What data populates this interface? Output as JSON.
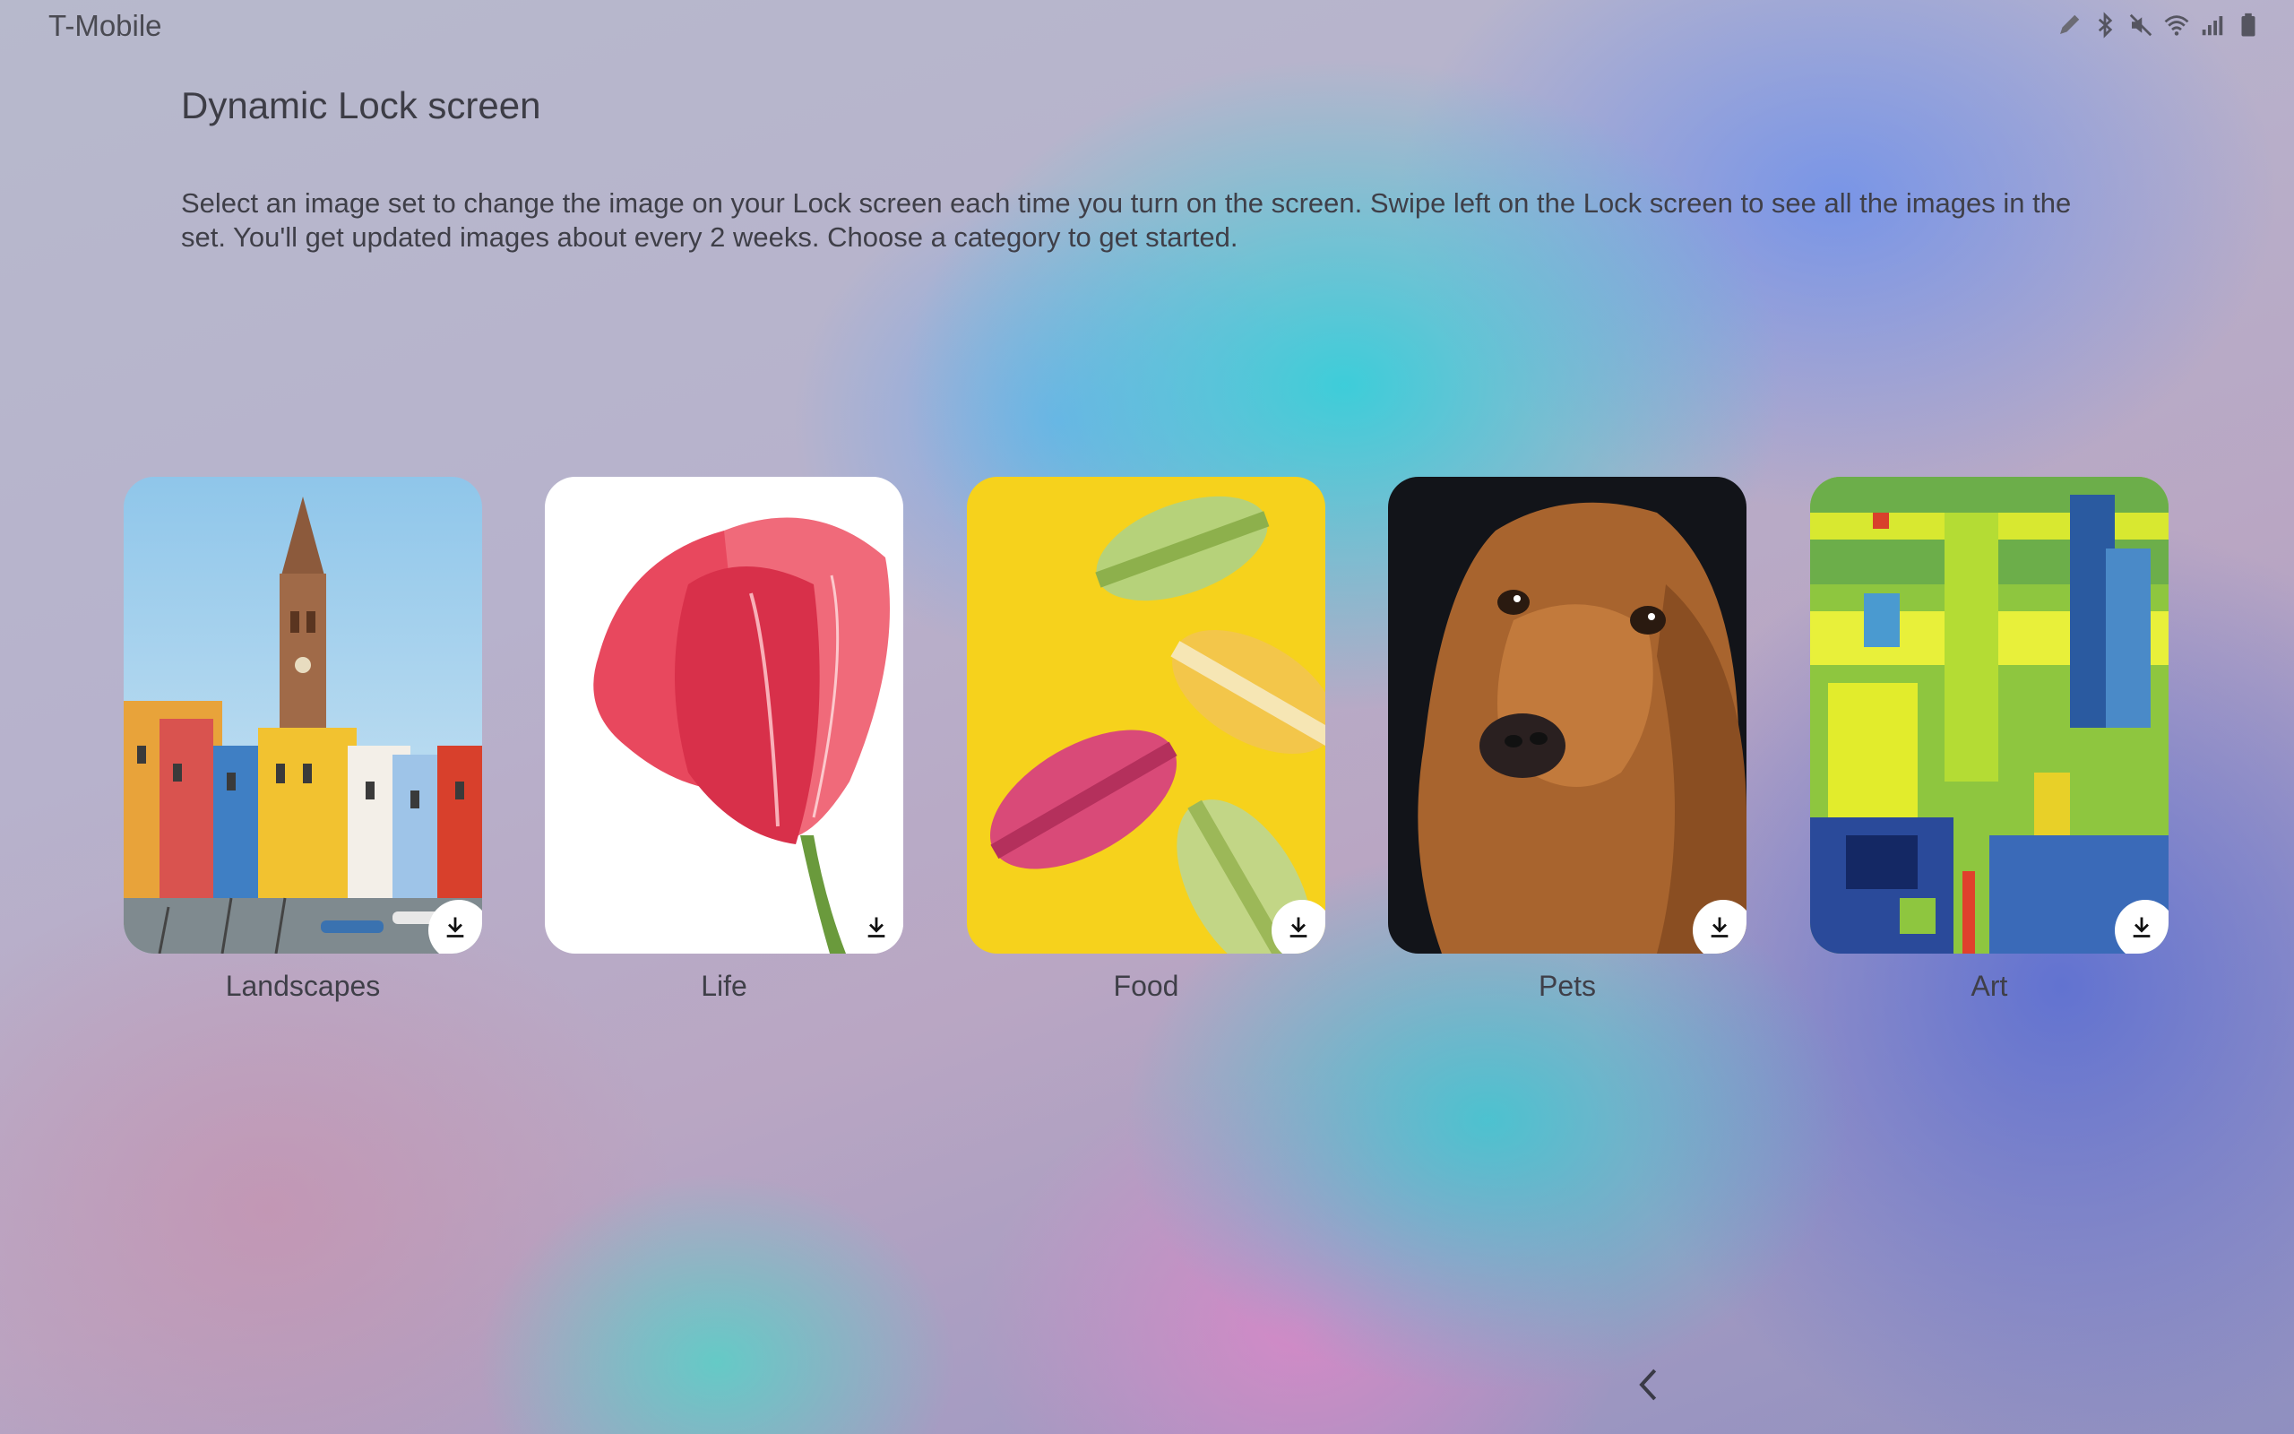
{
  "status_bar": {
    "carrier": "T-Mobile",
    "icons": [
      "pen-icon",
      "bluetooth-icon",
      "mute-icon",
      "wifi-icon",
      "signal-icon",
      "battery-icon"
    ]
  },
  "header": {
    "title": "Dynamic Lock screen",
    "description": "Select an image set to change the image on your Lock screen each time you turn on the screen. Swipe left on the Lock screen to see all the images in the set. You'll get updated images about every 2 weeks. Choose a category to get started."
  },
  "categories": [
    {
      "label": "Landscapes",
      "icon": "download-icon"
    },
    {
      "label": "Life",
      "icon": "download-icon"
    },
    {
      "label": "Food",
      "icon": "download-icon"
    },
    {
      "label": "Pets",
      "icon": "download-icon"
    },
    {
      "label": "Art",
      "icon": "download-icon"
    }
  ],
  "nav": {
    "back_icon": "back-chevron-icon"
  },
  "colors": {
    "text": "#3d3d46",
    "download_bg": "#ffffff"
  }
}
